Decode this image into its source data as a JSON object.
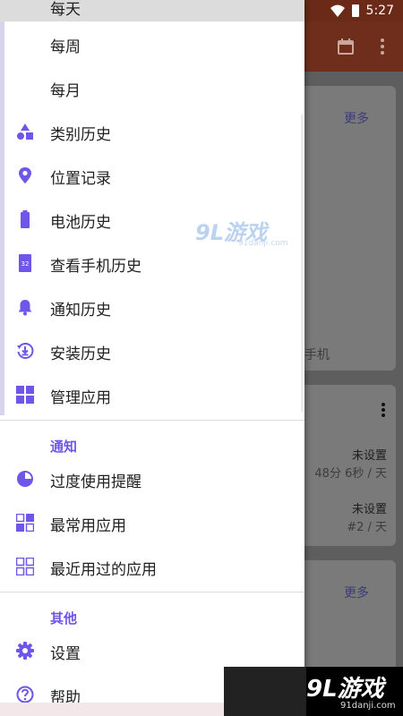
{
  "status": {
    "time": "5:27"
  },
  "drawer": {
    "items": [
      {
        "label": "每天",
        "icon": "none"
      },
      {
        "label": "每周",
        "icon": "none"
      },
      {
        "label": "每月",
        "icon": "none"
      },
      {
        "label": "类别历史",
        "icon": "shapes-icon"
      },
      {
        "label": "位置记录",
        "icon": "location-pin-icon"
      },
      {
        "label": "电池历史",
        "icon": "battery-icon"
      },
      {
        "label": "查看手机历史",
        "icon": "calendar-32-icon",
        "badge": "32"
      },
      {
        "label": "通知历史",
        "icon": "bell-icon"
      },
      {
        "label": "安装历史",
        "icon": "history-download-icon"
      },
      {
        "label": "管理应用",
        "icon": "grid-icon"
      }
    ],
    "sections": [
      {
        "title": "通知",
        "items": [
          {
            "label": "过度使用提醒",
            "icon": "pie-icon"
          },
          {
            "label": "最常用应用",
            "icon": "grid-partial-icon"
          },
          {
            "label": "最近用过的应用",
            "icon": "grid-outline-icon"
          }
        ]
      },
      {
        "title": "其他",
        "items": [
          {
            "label": "设置",
            "icon": "gear-icon"
          },
          {
            "label": "帮助",
            "icon": "help-icon"
          }
        ]
      }
    ]
  },
  "background": {
    "card1": {
      "more": "更多",
      "phone_text": "手机"
    },
    "card2": {
      "row1_value": "未设置",
      "row1_sub": "48分 6秒 / 天",
      "row2_value": "未设置",
      "row2_sub": "#2 / 天"
    },
    "card3": {
      "more": "更多"
    }
  },
  "watermark": {
    "brand": "9L游戏",
    "domain": "91danji.com"
  },
  "colors": {
    "accent": "#6f55e8",
    "appbar": "#6f2e1b",
    "statusbar": "#6b2a17"
  }
}
